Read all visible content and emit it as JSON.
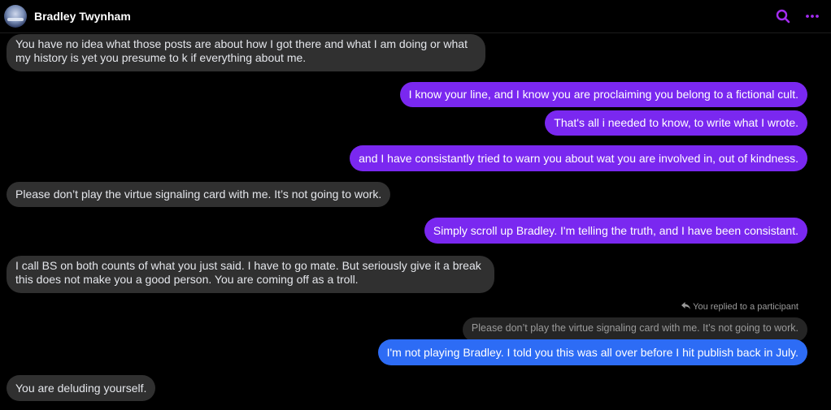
{
  "header": {
    "contact_name": "Bradley Twynham",
    "search_icon": "search-icon",
    "more_icon": "more-icon",
    "accent_color": "#a32cf0"
  },
  "messages": [
    {
      "direction": "incoming",
      "text": "You have no idea what those posts are about how I got there and what I am doing or what my history is yet you presume to k if everything about me."
    },
    {
      "direction": "outgoing",
      "text": "I know your line, and I know you are proclaiming you belong to a fictional cult."
    },
    {
      "direction": "outgoing",
      "text": "That's all i needed to know, to write what I wrote."
    },
    {
      "direction": "outgoing",
      "text": "and I have consistantly tried to warn you about wat you are involved in, out of kindness."
    },
    {
      "direction": "incoming",
      "text": "Please don’t play the virtue signaling card with me. It’s not going to work."
    },
    {
      "direction": "outgoing",
      "text": "Simply scroll up Bradley. I'm telling the truth, and I have been consistant."
    },
    {
      "direction": "incoming",
      "text": "I call BS on both counts of what you just said. I have to go mate. But seriously give it a break this does not make you a good person. You are coming off as a troll."
    },
    {
      "direction": "outgoing",
      "reply_label": "You replied to a participant",
      "quoted": "Please don’t play the virtue signaling card with me. It’s not going to work.",
      "text": "I'm not playing Bradley. I told you this was all over before I hit publish back in July."
    },
    {
      "direction": "incoming",
      "text": "You are deluding yourself."
    }
  ],
  "colors": {
    "background": "#000000",
    "incoming_bubble": "#303030",
    "outgoing_bubble": "#7a28f0",
    "outgoing_reply_bubble": "#2d6cf5",
    "quote_bubble": "#252525"
  }
}
